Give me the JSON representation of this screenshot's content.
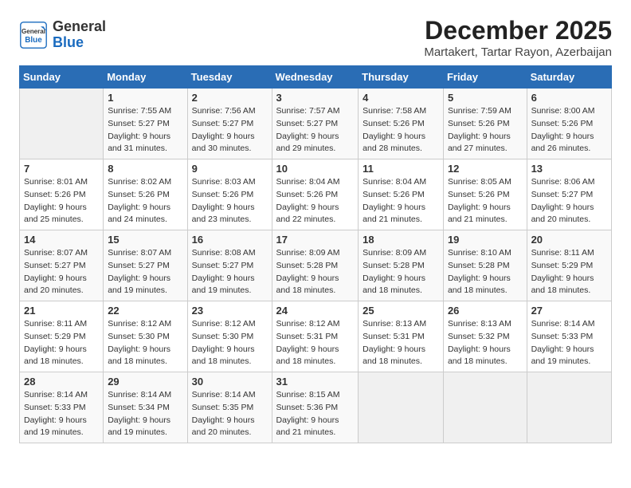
{
  "header": {
    "logo_general": "General",
    "logo_blue": "Blue",
    "month_title": "December 2025",
    "location": "Martakert, Tartar Rayon, Azerbaijan"
  },
  "weekdays": [
    "Sunday",
    "Monday",
    "Tuesday",
    "Wednesday",
    "Thursday",
    "Friday",
    "Saturday"
  ],
  "weeks": [
    [
      {
        "day": "",
        "sunrise": "",
        "sunset": "",
        "daylight": ""
      },
      {
        "day": "1",
        "sunrise": "Sunrise: 7:55 AM",
        "sunset": "Sunset: 5:27 PM",
        "daylight": "Daylight: 9 hours and 31 minutes."
      },
      {
        "day": "2",
        "sunrise": "Sunrise: 7:56 AM",
        "sunset": "Sunset: 5:27 PM",
        "daylight": "Daylight: 9 hours and 30 minutes."
      },
      {
        "day": "3",
        "sunrise": "Sunrise: 7:57 AM",
        "sunset": "Sunset: 5:27 PM",
        "daylight": "Daylight: 9 hours and 29 minutes."
      },
      {
        "day": "4",
        "sunrise": "Sunrise: 7:58 AM",
        "sunset": "Sunset: 5:26 PM",
        "daylight": "Daylight: 9 hours and 28 minutes."
      },
      {
        "day": "5",
        "sunrise": "Sunrise: 7:59 AM",
        "sunset": "Sunset: 5:26 PM",
        "daylight": "Daylight: 9 hours and 27 minutes."
      },
      {
        "day": "6",
        "sunrise": "Sunrise: 8:00 AM",
        "sunset": "Sunset: 5:26 PM",
        "daylight": "Daylight: 9 hours and 26 minutes."
      }
    ],
    [
      {
        "day": "7",
        "sunrise": "Sunrise: 8:01 AM",
        "sunset": "Sunset: 5:26 PM",
        "daylight": "Daylight: 9 hours and 25 minutes."
      },
      {
        "day": "8",
        "sunrise": "Sunrise: 8:02 AM",
        "sunset": "Sunset: 5:26 PM",
        "daylight": "Daylight: 9 hours and 24 minutes."
      },
      {
        "day": "9",
        "sunrise": "Sunrise: 8:03 AM",
        "sunset": "Sunset: 5:26 PM",
        "daylight": "Daylight: 9 hours and 23 minutes."
      },
      {
        "day": "10",
        "sunrise": "Sunrise: 8:04 AM",
        "sunset": "Sunset: 5:26 PM",
        "daylight": "Daylight: 9 hours and 22 minutes."
      },
      {
        "day": "11",
        "sunrise": "Sunrise: 8:04 AM",
        "sunset": "Sunset: 5:26 PM",
        "daylight": "Daylight: 9 hours and 21 minutes."
      },
      {
        "day": "12",
        "sunrise": "Sunrise: 8:05 AM",
        "sunset": "Sunset: 5:26 PM",
        "daylight": "Daylight: 9 hours and 21 minutes."
      },
      {
        "day": "13",
        "sunrise": "Sunrise: 8:06 AM",
        "sunset": "Sunset: 5:27 PM",
        "daylight": "Daylight: 9 hours and 20 minutes."
      }
    ],
    [
      {
        "day": "14",
        "sunrise": "Sunrise: 8:07 AM",
        "sunset": "Sunset: 5:27 PM",
        "daylight": "Daylight: 9 hours and 20 minutes."
      },
      {
        "day": "15",
        "sunrise": "Sunrise: 8:07 AM",
        "sunset": "Sunset: 5:27 PM",
        "daylight": "Daylight: 9 hours and 19 minutes."
      },
      {
        "day": "16",
        "sunrise": "Sunrise: 8:08 AM",
        "sunset": "Sunset: 5:27 PM",
        "daylight": "Daylight: 9 hours and 19 minutes."
      },
      {
        "day": "17",
        "sunrise": "Sunrise: 8:09 AM",
        "sunset": "Sunset: 5:28 PM",
        "daylight": "Daylight: 9 hours and 18 minutes."
      },
      {
        "day": "18",
        "sunrise": "Sunrise: 8:09 AM",
        "sunset": "Sunset: 5:28 PM",
        "daylight": "Daylight: 9 hours and 18 minutes."
      },
      {
        "day": "19",
        "sunrise": "Sunrise: 8:10 AM",
        "sunset": "Sunset: 5:28 PM",
        "daylight": "Daylight: 9 hours and 18 minutes."
      },
      {
        "day": "20",
        "sunrise": "Sunrise: 8:11 AM",
        "sunset": "Sunset: 5:29 PM",
        "daylight": "Daylight: 9 hours and 18 minutes."
      }
    ],
    [
      {
        "day": "21",
        "sunrise": "Sunrise: 8:11 AM",
        "sunset": "Sunset: 5:29 PM",
        "daylight": "Daylight: 9 hours and 18 minutes."
      },
      {
        "day": "22",
        "sunrise": "Sunrise: 8:12 AM",
        "sunset": "Sunset: 5:30 PM",
        "daylight": "Daylight: 9 hours and 18 minutes."
      },
      {
        "day": "23",
        "sunrise": "Sunrise: 8:12 AM",
        "sunset": "Sunset: 5:30 PM",
        "daylight": "Daylight: 9 hours and 18 minutes."
      },
      {
        "day": "24",
        "sunrise": "Sunrise: 8:12 AM",
        "sunset": "Sunset: 5:31 PM",
        "daylight": "Daylight: 9 hours and 18 minutes."
      },
      {
        "day": "25",
        "sunrise": "Sunrise: 8:13 AM",
        "sunset": "Sunset: 5:31 PM",
        "daylight": "Daylight: 9 hours and 18 minutes."
      },
      {
        "day": "26",
        "sunrise": "Sunrise: 8:13 AM",
        "sunset": "Sunset: 5:32 PM",
        "daylight": "Daylight: 9 hours and 18 minutes."
      },
      {
        "day": "27",
        "sunrise": "Sunrise: 8:14 AM",
        "sunset": "Sunset: 5:33 PM",
        "daylight": "Daylight: 9 hours and 19 minutes."
      }
    ],
    [
      {
        "day": "28",
        "sunrise": "Sunrise: 8:14 AM",
        "sunset": "Sunset: 5:33 PM",
        "daylight": "Daylight: 9 hours and 19 minutes."
      },
      {
        "day": "29",
        "sunrise": "Sunrise: 8:14 AM",
        "sunset": "Sunset: 5:34 PM",
        "daylight": "Daylight: 9 hours and 19 minutes."
      },
      {
        "day": "30",
        "sunrise": "Sunrise: 8:14 AM",
        "sunset": "Sunset: 5:35 PM",
        "daylight": "Daylight: 9 hours and 20 minutes."
      },
      {
        "day": "31",
        "sunrise": "Sunrise: 8:15 AM",
        "sunset": "Sunset: 5:36 PM",
        "daylight": "Daylight: 9 hours and 21 minutes."
      },
      {
        "day": "",
        "sunrise": "",
        "sunset": "",
        "daylight": ""
      },
      {
        "day": "",
        "sunrise": "",
        "sunset": "",
        "daylight": ""
      },
      {
        "day": "",
        "sunrise": "",
        "sunset": "",
        "daylight": ""
      }
    ]
  ]
}
